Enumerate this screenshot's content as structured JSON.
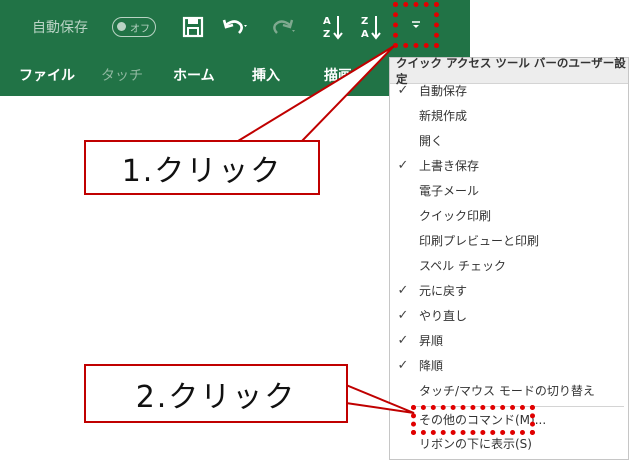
{
  "qat": {
    "autosave_label": "自動保存",
    "toggle_state": "オフ"
  },
  "tabs": [
    {
      "label": "ファイル"
    },
    {
      "label": "タッチ"
    },
    {
      "label": "ホーム"
    },
    {
      "label": "挿入"
    },
    {
      "label": "描画"
    }
  ],
  "menu": {
    "title": "クイック アクセス ツール バーのユーザー設定",
    "items": [
      {
        "label": "自動保存",
        "check": "✓"
      },
      {
        "label": "新規作成",
        "check": ""
      },
      {
        "label": "開く",
        "check": ""
      },
      {
        "label": "上書き保存",
        "check": "✓"
      },
      {
        "label": "電子メール",
        "check": ""
      },
      {
        "label": "クイック印刷",
        "check": ""
      },
      {
        "label": "印刷プレビューと印刷",
        "check": ""
      },
      {
        "label": "スペル チェック",
        "check": ""
      },
      {
        "label": "元に戻す",
        "check": "✓"
      },
      {
        "label": "やり直し",
        "check": "✓"
      },
      {
        "label": "昇順",
        "check": "✓"
      },
      {
        "label": "降順",
        "check": "✓"
      },
      {
        "label": "タッチ/マウス モードの切り替え",
        "check": ""
      },
      {
        "label": "その他のコマンド(M)...",
        "check": ""
      },
      {
        "label": "リボンの下に表示(S)",
        "check": ""
      }
    ]
  },
  "callouts": {
    "step1": "1.クリック",
    "step2": "2.クリック"
  },
  "colors": {
    "ribbon": "#217346",
    "highlight": "#e00000"
  }
}
